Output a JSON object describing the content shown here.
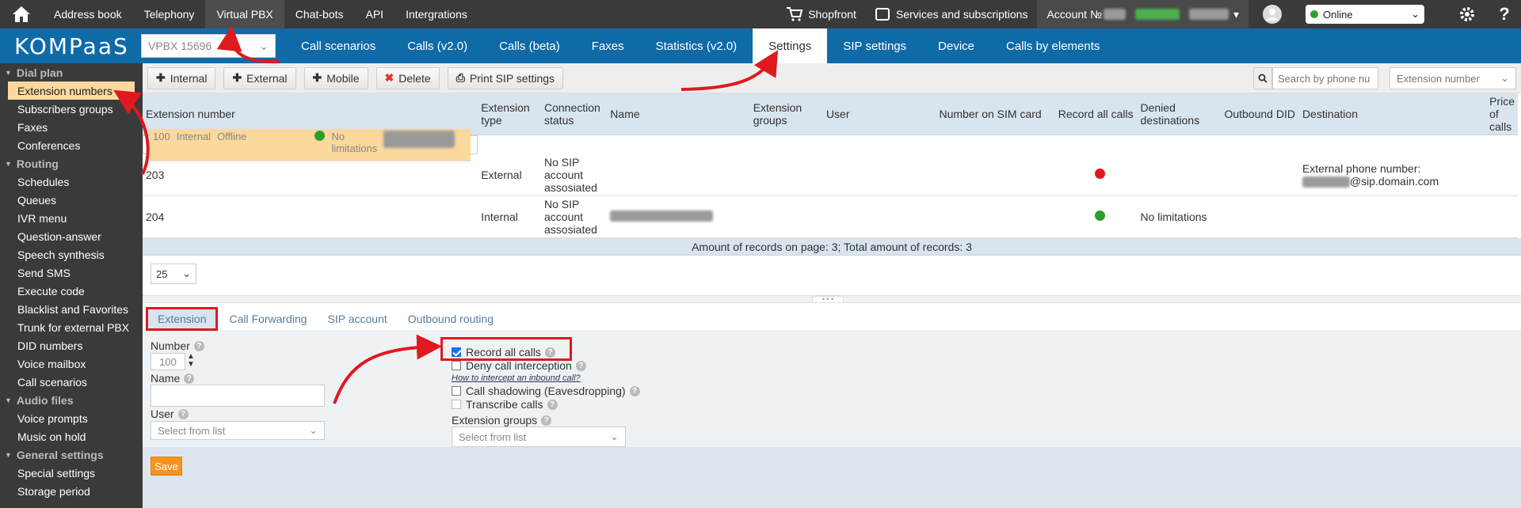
{
  "topnav": {
    "items": [
      "Address book",
      "Telephony",
      "Virtual PBX",
      "Chat-bots",
      "API",
      "Intergrations"
    ],
    "active": 2,
    "shopfront": "Shopfront",
    "services": "Services and subscriptions",
    "account_label": "Account №",
    "status": "Online"
  },
  "colors": {
    "topbar": "#3a3a3a",
    "accent": "#0f6aa8",
    "highlight": "#fbd89c",
    "red": "#e0191e",
    "green": "#2ca02c",
    "save": "#f7931e"
  },
  "secnav": {
    "logo": "KOMPaaS",
    "vpbx": "VPBX 15696",
    "tabs": [
      "Call scenarios",
      "Calls (v2.0)",
      "Calls (beta)",
      "Faxes",
      "Statistics (v2.0)",
      "Settings",
      "SIP settings",
      "Device",
      "Calls by elements"
    ],
    "active": 5
  },
  "sidebar": [
    {
      "group": "Dial plan",
      "items": [
        "Extension numbers",
        "Subscribers groups",
        "Faxes",
        "Conferences"
      ]
    },
    {
      "group": "Routing",
      "items": [
        "Schedules",
        "Queues",
        "IVR menu",
        "Question-answer",
        "Speech synthesis",
        "Send SMS",
        "Execute code",
        "Blacklist and Favorites",
        "Trunk for external PBX",
        "DID numbers",
        "Voice mailbox",
        "Call scenarios"
      ]
    },
    {
      "group": "Audio files",
      "items": [
        "Voice prompts",
        "Music on hold"
      ]
    },
    {
      "group": "General settings",
      "items": [
        "Special settings",
        "Storage period"
      ]
    }
  ],
  "toolbar": {
    "internal": "Internal",
    "external": "External",
    "mobile": "Mobile",
    "delete": "Delete",
    "print": "Print SIP settings",
    "search_placeholder": "Search by phone nu",
    "ext_select": "Extension number"
  },
  "table": {
    "headers": [
      "Extension number",
      "Extension type",
      "Connection status",
      "Name",
      "Extension groups",
      "User",
      "Number on SIM card",
      "Record all calls",
      "Denied destinations",
      "Outbound DID",
      "Destination",
      "Price of calls"
    ],
    "rows": [
      {
        "num": "100",
        "type": "Internal",
        "status": "Offline",
        "record": "green",
        "denied": "No limitations",
        "dest": ""
      },
      {
        "num": "203",
        "type": "External",
        "status": "No SIP account assosiated",
        "record": "red",
        "denied": "",
        "dest": "External phone number:",
        "dest2": "@sip.domain.com"
      },
      {
        "num": "204",
        "type": "Internal",
        "status": "No SIP account assosiated",
        "record": "green",
        "denied": "No limitations",
        "dest": ""
      }
    ],
    "footer": "Amount of records on page: 3; Total amount of records: 3",
    "page_size": "25"
  },
  "btabs": [
    "Extension",
    "Call Forwarding",
    "SIP account",
    "Outbound routing"
  ],
  "form": {
    "number_label": "Number",
    "number_value": "100",
    "name_label": "Name",
    "user_label": "User",
    "user_select": "Select from list",
    "record_all": "Record all calls",
    "deny_interception": "Deny call interception",
    "how_to": "How to intercept an inbound call?",
    "shadowing": "Call shadowing (Eavesdropping)",
    "transcribe": "Transcribe calls",
    "groups_label": "Extension groups",
    "groups_select": "Select from list",
    "save": "Save"
  }
}
